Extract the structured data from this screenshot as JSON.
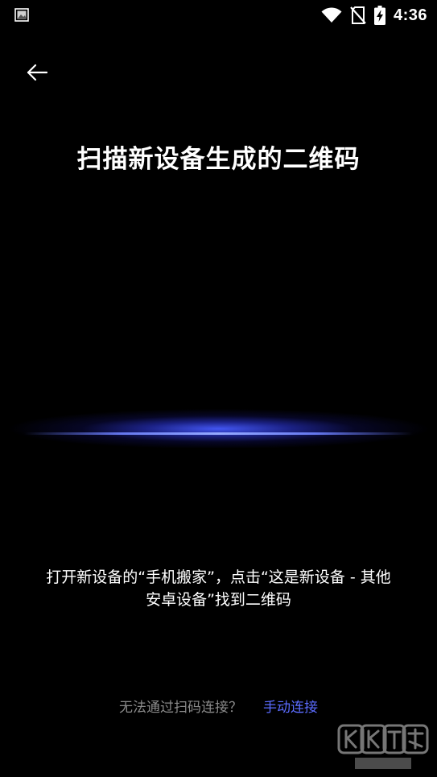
{
  "status_bar": {
    "time": "4:36",
    "icons": [
      "notification-image-icon",
      "wifi-icon",
      "no-sim-icon",
      "battery-charging-icon"
    ]
  },
  "header": {
    "back_icon": "arrow-left-icon",
    "title": "扫描新设备生成的二维码"
  },
  "instruction": {
    "line1": "打开新设备的“手机搬家”，点击“这是新设备 - 其他",
    "line2": "安卓设备”找到二维码"
  },
  "footer": {
    "prompt": "无法通过扫码连接？",
    "link": "手动连接"
  },
  "colors": {
    "background": "#000000",
    "text": "#ffffff",
    "muted": "#8a8a8a",
    "accent": "#5b6cff",
    "scan_glow": "#4a5cff"
  }
}
